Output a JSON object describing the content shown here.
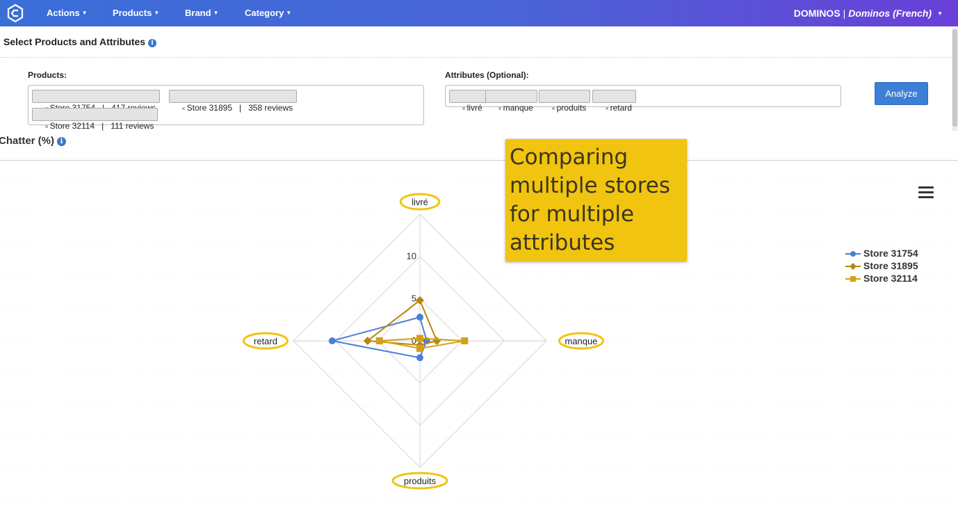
{
  "nav": {
    "items": [
      {
        "label": "Actions"
      },
      {
        "label": "Products"
      },
      {
        "label": "Brand"
      },
      {
        "label": "Category"
      }
    ],
    "account_brand": "DOMINOS",
    "account_separator": "|",
    "account_language": "Dominos (French)"
  },
  "section": {
    "title": "Select Products and Attributes",
    "products_label": "Products:",
    "attributes_label": "Attributes (Optional):",
    "products": [
      "Store 31754   |   417 reviews",
      "Store 31895   |   358 reviews",
      "Store 32114   |   111 reviews"
    ],
    "attributes": [
      "livré",
      "manque",
      "produits",
      "retard"
    ],
    "analyze_label": "Analyze",
    "tag_remove_glyph": "×"
  },
  "chart_section": {
    "title": "Chatter (%)"
  },
  "callout": {
    "text": "Comparing multiple stores for multiple attributes"
  },
  "chart_data": {
    "type": "radar",
    "title": "",
    "categories": [
      "livré",
      "manque",
      "produits",
      "retard"
    ],
    "radial_ticks": [
      0,
      5,
      10
    ],
    "radial_max": 15,
    "grid": true,
    "legend_position": "right",
    "highlighted_axis_labels": true,
    "highlight_color": "#f1c40f",
    "series": [
      {
        "name": "Store 31754",
        "values": [
          2.8,
          0.8,
          2.0,
          10.4
        ],
        "color": "#4a7fd6",
        "marker": "circle"
      },
      {
        "name": "Store 31895",
        "values": [
          4.8,
          2.0,
          0.5,
          6.2
        ],
        "color": "#b8860b",
        "marker": "diamond"
      },
      {
        "name": "Store 32114",
        "values": [
          0.3,
          5.3,
          0.9,
          4.8
        ],
        "color": "#d4a017",
        "marker": "square"
      }
    ]
  }
}
